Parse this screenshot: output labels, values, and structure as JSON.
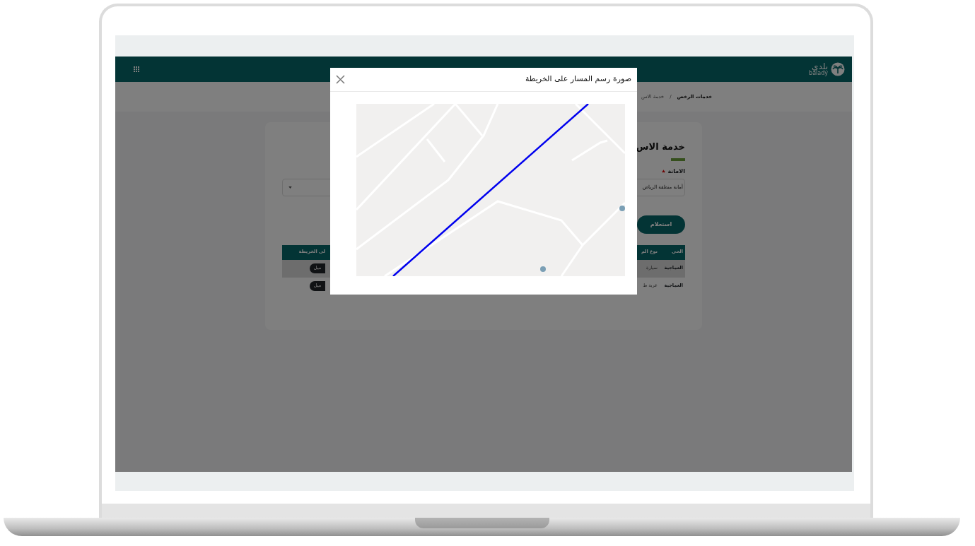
{
  "navbar": {
    "logo_text": "بلدي",
    "logo_subtext": "balady"
  },
  "breadcrumb": {
    "separator": "/",
    "items": [
      {
        "label": "خدمات الرخص",
        "kind": "link"
      },
      {
        "label": "خدمة الاس",
        "kind": "current"
      }
    ]
  },
  "page": {
    "title": "خدمة الاس",
    "field_label": "الامانة",
    "required": true,
    "select_value": "أمانة منطقة الرياض",
    "submit_button": "استعلام"
  },
  "table": {
    "columns": [
      "الحي",
      "نوع الم",
      "لى الخريطة"
    ],
    "rows": [
      {
        "cells": [
          "العماجية",
          "سيارة"
        ],
        "action": "ميل",
        "selected": true
      },
      {
        "cells": [
          "العماجية",
          "عربة ط"
        ],
        "action": "ميل",
        "selected": false
      }
    ]
  },
  "modal": {
    "title": "صورة رسم المسار على الخريطة"
  }
}
